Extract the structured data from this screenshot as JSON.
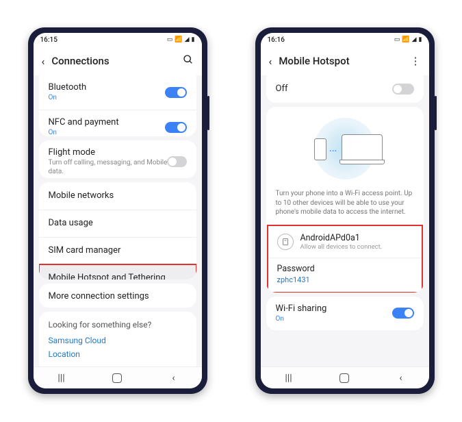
{
  "left": {
    "status_time": "16:15",
    "header_title": "Connections",
    "rows": {
      "bluetooth": {
        "label": "Bluetooth",
        "sub": "On"
      },
      "nfc": {
        "label": "NFC and payment",
        "sub": "On"
      },
      "flight": {
        "label": "Flight mode",
        "sub": "Turn off calling, messaging, and Mobile data."
      },
      "mobile_networks": {
        "label": "Mobile networks"
      },
      "data_usage": {
        "label": "Data usage"
      },
      "sim": {
        "label": "SIM card manager"
      },
      "hotspot": {
        "label": "Mobile Hotspot and Tethering"
      },
      "more": {
        "label": "More connection settings"
      }
    },
    "prompt": {
      "q": "Looking for something else?",
      "link1": "Samsung Cloud",
      "link2": "Location"
    }
  },
  "right": {
    "status_time": "16:16",
    "header_title": "Mobile Hotspot",
    "off_label": "Off",
    "descr": "Turn your phone into a Wi-Fi access point. Up to 10 other devices will be able to use your phone's mobile data to access the internet.",
    "network": {
      "name": "AndroidAPd0a1",
      "sub": "Allow all devices to connect."
    },
    "password": {
      "label": "Password",
      "value": "zphc1431"
    },
    "wifi_sharing": {
      "label": "Wi-Fi sharing",
      "sub": "On"
    }
  }
}
